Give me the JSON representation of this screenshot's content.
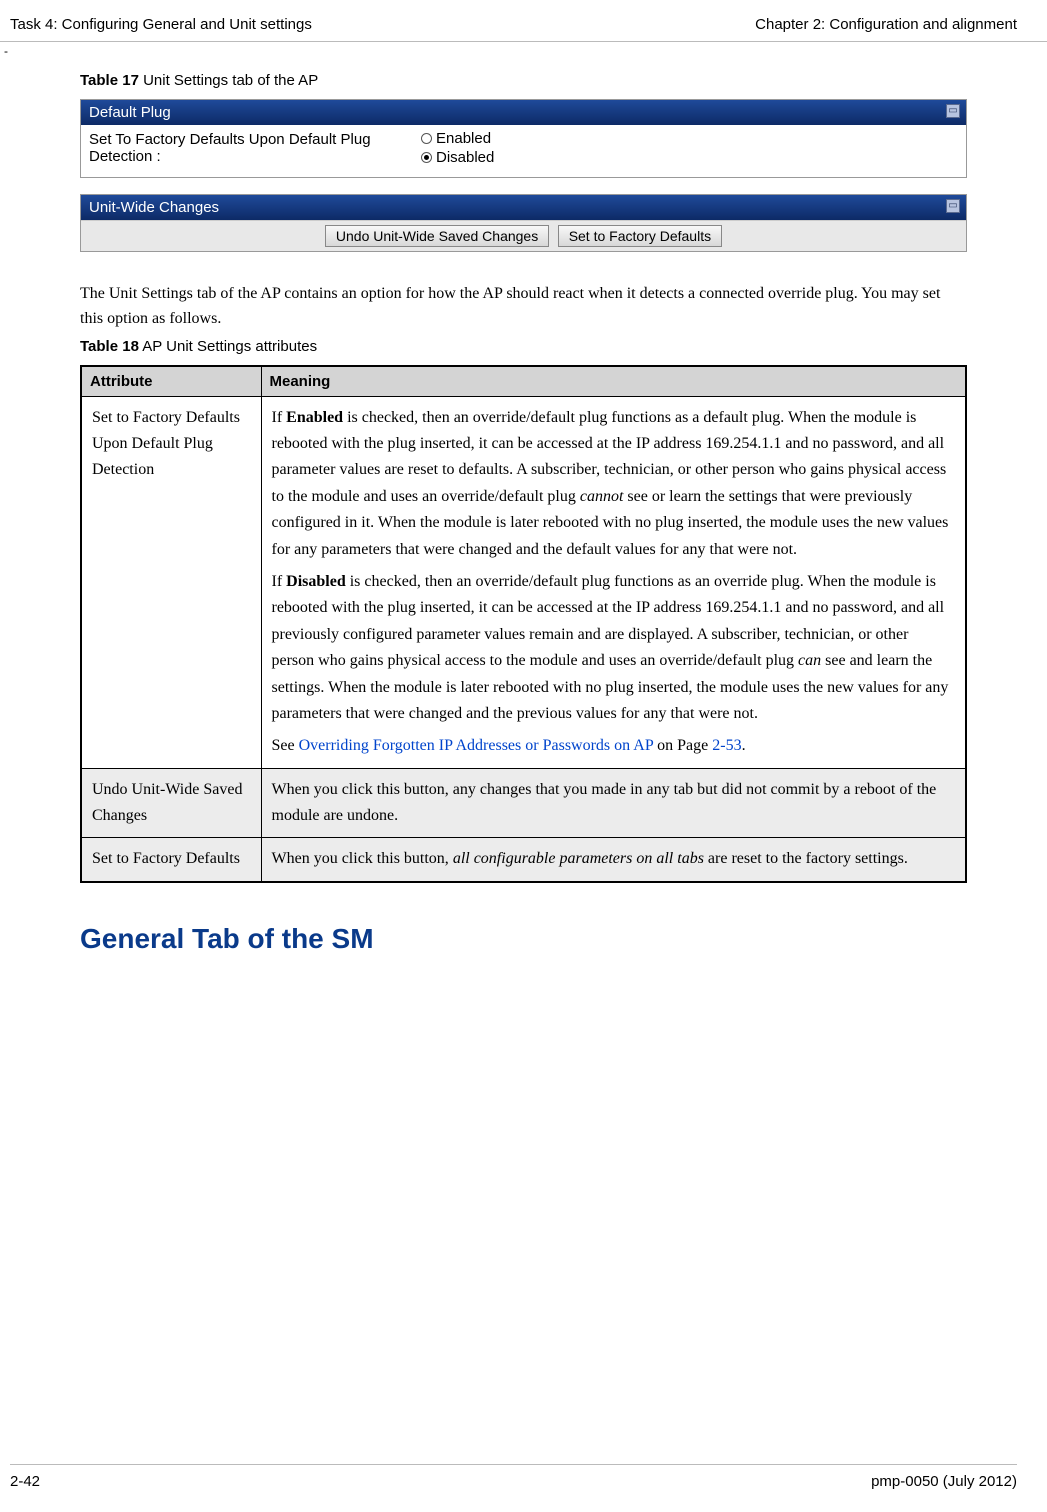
{
  "header": {
    "left": "Task 4: Configuring General and Unit settings",
    "right": "Chapter 2:  Configuration and alignment",
    "dash": "-"
  },
  "table17": {
    "caption_bold": "Table 17",
    "caption_rest": "  Unit Settings tab of the AP"
  },
  "settings": {
    "default_plug": {
      "title": "Default Plug",
      "label": "Set To Factory Defaults Upon Default Plug Detection :",
      "opt_enabled": "Enabled",
      "opt_disabled": "Disabled"
    },
    "unit_wide": {
      "title": "Unit-Wide Changes",
      "btn_undo": "Undo Unit-Wide Saved Changes",
      "btn_factory": "Set to Factory Defaults"
    }
  },
  "intro": "The Unit Settings tab of the AP contains an option for how the AP should react when it detects a connected override plug. You may set this option as follows.",
  "table18": {
    "caption_bold": "Table 18",
    "caption_rest": "  AP Unit Settings attributes",
    "headers": {
      "col1": "Attribute",
      "col2": "Meaning"
    },
    "rows": {
      "r1": {
        "attr": "Set to Factory Defaults Upon Default Plug Detection",
        "p1a": "If ",
        "p1b": "Enabled",
        "p1c": " is checked, then an override/default plug functions as a default plug. When the module is rebooted with the plug inserted, it can be accessed at the IP address 169.254.1.1 and no password, and all parameter values are reset to defaults. A subscriber, technician, or other person who gains physical access to the module and uses an override/default plug ",
        "p1d": "cannot",
        "p1e": " see or learn the settings that were previously configured in it. When the module is later rebooted with no plug inserted, the module uses the new values for any parameters that were changed and the default values for any that were not.",
        "p2a": "If ",
        "p2b": "Disabled",
        "p2c": " is checked, then an override/default plug functions as an override plug. When the module is rebooted with the plug inserted, it can be accessed at the IP address 169.254.1.1 and no password, and all previously configured parameter values remain and are displayed. A subscriber, technician, or other person who gains physical access to the module and uses an override/default plug ",
        "p2d": "can",
        "p2e": " see and learn the settings. When the module is later rebooted with no plug inserted, the module uses the new values for any parameters that were changed and the previous values for any that were not.",
        "p3a": "See ",
        "p3b": "Overriding Forgotten IP Addresses or Passwords on AP",
        "p3c": " on Page ",
        "p3d": "2-53",
        "p3e": "."
      },
      "r2": {
        "attr": "Undo Unit-Wide Saved Changes",
        "meaning": "When you click this button, any changes that you made in any tab but did not commit by a reboot of the module are undone."
      },
      "r3": {
        "attr": "Set to Factory Defaults",
        "p1a": "When you click this button, ",
        "p1b": "all configurable parameters on all tabs",
        "p1c": " are reset to the factory settings."
      }
    }
  },
  "section_heading": "General Tab of the SM",
  "footer": {
    "left": "2-42",
    "right": "pmp-0050 (July 2012)"
  }
}
